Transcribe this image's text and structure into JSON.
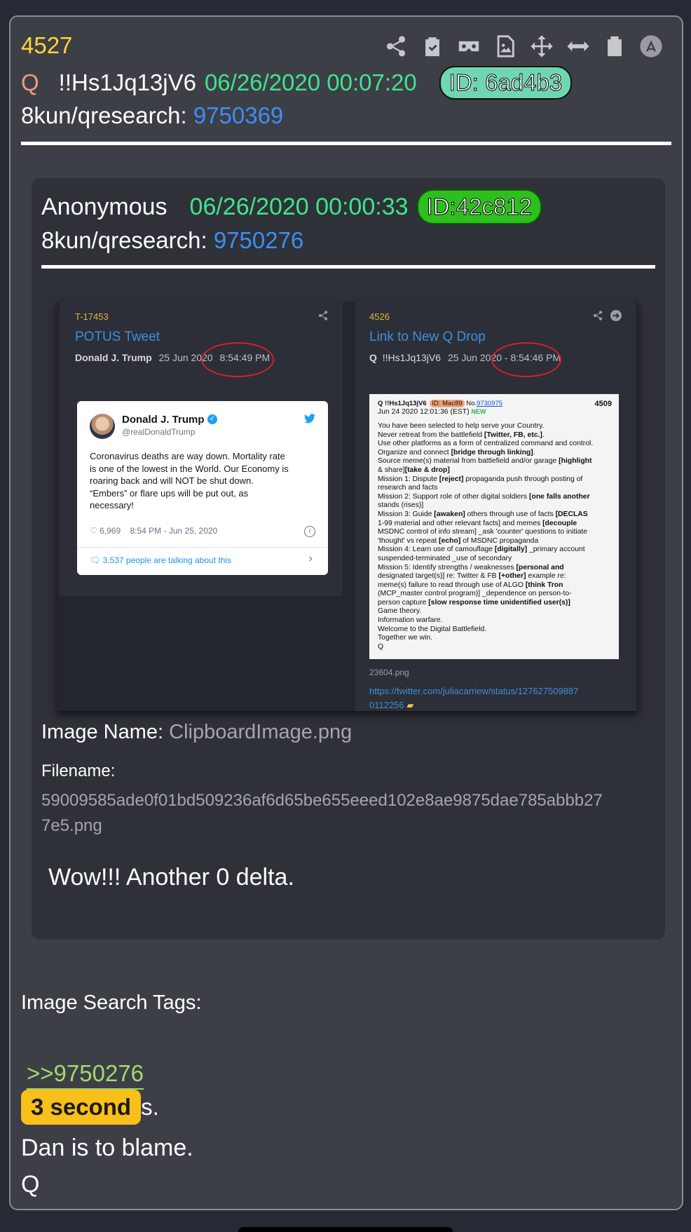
{
  "post": {
    "number": "4527",
    "author": "Q",
    "tripcode": "!!Hs1Jq13jV6",
    "datetime": "06/26/2020 00:07:20",
    "id_badge": "ID: 6ad4b3",
    "id_badge_color": "#6fd6b2",
    "board_label": "8kun/qresearch:",
    "board_post": "9750369"
  },
  "toolbar": {
    "icons": [
      "share-icon",
      "clipboard-check-icon",
      "vr-goggles-icon",
      "image-file-icon",
      "move-icon",
      "expand-horizontal-icon",
      "clipboard-icon",
      "avatar-icon"
    ]
  },
  "quoted": {
    "author": "Anonymous",
    "datetime": "06/26/2020 00:00:33",
    "id_badge": "ID:42c812",
    "board_label": "8kun/qresearch:",
    "board_post": "9750276",
    "image_name_label": "Image Name:",
    "image_name": "ClipboardImage.png",
    "filename_label": "Filename:",
    "filename_line1": "59009585ade0f01bd509236af6d65be655eeed102e8ae9875dae785abbb27",
    "filename_line2": "7e5.png",
    "message": "Wow!!! Another 0 delta."
  },
  "screenshot": {
    "left": {
      "num": "T-17453",
      "title": "POTUS Tweet",
      "author": "Donald J. Trump",
      "date": "25 Jun 2020",
      "time": "8:54:49 PM",
      "tweet": {
        "name": "Donald J. Trump",
        "handle": "@realDonaldTrump",
        "text1": "Coronavirus deaths are way down. Mortality rate",
        "text2": "is one of the lowest in the World. Our Economy is",
        "text3": "roaring back and will NOT be shut down.",
        "text4": "“Embers” or flare ups will be put out, as",
        "text5": "necessary!",
        "likes": "6,969",
        "stamp": "8:54 PM - Jun 25, 2020",
        "talking": "3,537 people are talking about this"
      }
    },
    "right": {
      "num": "4526",
      "title": "Link to New Q Drop",
      "author": "Q",
      "trip": "!!Hs1Jq13jV6",
      "date": "25 Jun 2020",
      "time": "- 8:54:46 PM",
      "img_header_left": "Q !!Hs1Jq13jV6",
      "img_header_id": "ID: Mac89",
      "img_header_no": "No.",
      "img_header_link": "9730975",
      "img_header_num": "4509",
      "img_date": "Jun 24 2020 12:01:36 (EST)",
      "img_new": "NEW",
      "lines": [
        "You have been selected to help serve your Country.",
        "Never retreat from the battlefield [Twitter, FB, etc.].",
        "Use other platforms as a form of centralized command and control.",
        "Organize and connect [bridge through linking].",
        "Source meme(s) material from battlefield and/or garage [highlight",
        "& share][take & drop]",
        "Mission 1: Dispute [reject] propaganda push through posting of",
        "research and facts",
        "Mission 2: Support role of other digital soldiers [one falls another",
        "stands (rises)]",
        "Mission 3: Guide [awaken] others through use of facts [DECLAS",
        "1-99 material and other relevant facts] and memes [decouple",
        "MSDNC control of info stream] _ask 'counter' questions to initiate",
        "'thought' vs repeat [echo] of MSDNC propaganda",
        "Mission 4: Learn use of camouflage [digitally] _primary account",
        "suspended-terminated _use of secondary",
        "Mission 5: Identify strengths / weaknesses [personal and",
        "designated target(s)] re: Twitter & FB [+other] example re:",
        "meme(s) failure to read through use of ALGO [think Tron",
        "(MCP_master control program)] _dependence on person-to-",
        "person capture [slow response time unidentified user(s)]",
        "Game theory.",
        "Information warfare.",
        "Welcome to the Digital Battlefield.",
        "Together we win.",
        "Q"
      ],
      "img_filename": "23604.png",
      "url1": "https://twitter.com/juliacarriew/status/127627509887",
      "url2": "0112256"
    }
  },
  "footer": {
    "tags_label": "Image Search Tags:",
    "reply_link": ">>9750276",
    "highlight": "3 second",
    "after_highlight": "s.",
    "line2": "Dan is to blame.",
    "signature": "Q"
  }
}
